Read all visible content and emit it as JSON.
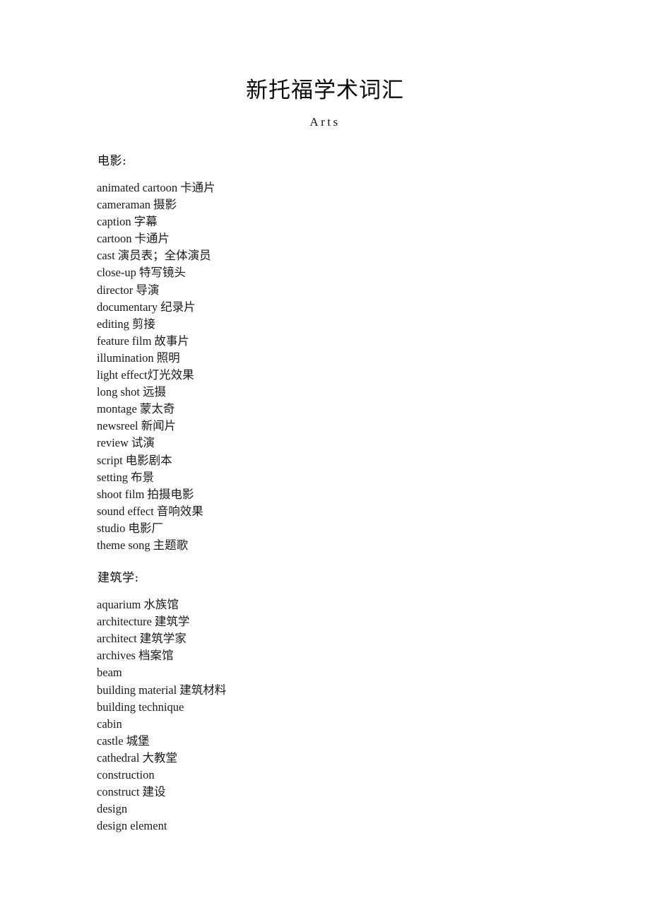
{
  "document": {
    "title": "新托福学术词汇",
    "subtitle": "Arts",
    "sections": [
      {
        "heading": "电影:",
        "entries": [
          {
            "term": "animated cartoon",
            "gloss": "卡通片"
          },
          {
            "term": "cameraman",
            "gloss": "摄影"
          },
          {
            "term": "caption",
            "gloss": "字幕"
          },
          {
            "term": "cartoon",
            "gloss": "卡通片"
          },
          {
            "term": "cast",
            "gloss": "演员表；全体演员"
          },
          {
            "term": "close-up",
            "gloss": "特写镜头"
          },
          {
            "term": "director",
            "gloss": "导演"
          },
          {
            "term": "documentary",
            "gloss": "纪录片"
          },
          {
            "term": "editing",
            "gloss": "剪接"
          },
          {
            "term": "feature film",
            "gloss": "故事片"
          },
          {
            "term": "illumination",
            "gloss": "照明"
          },
          {
            "term": "light effect",
            "gloss": "灯光效果",
            "tight": true
          },
          {
            "term": "long shot",
            "gloss": "远摄"
          },
          {
            "term": "montage",
            "gloss": "蒙太奇"
          },
          {
            "term": "newsreel",
            "gloss": "新闻片"
          },
          {
            "term": "review",
            "gloss": "试演"
          },
          {
            "term": "script",
            "gloss": "电影剧本"
          },
          {
            "term": "setting",
            "gloss": "布景"
          },
          {
            "term": "shoot film",
            "gloss": "拍摄电影"
          },
          {
            "term": "sound effect",
            "gloss": "音响效果"
          },
          {
            "term": "studio",
            "gloss": "电影厂"
          },
          {
            "term": "theme song",
            "gloss": "主题歌"
          }
        ]
      },
      {
        "heading": "建筑学:",
        "entries": [
          {
            "term": "aquarium",
            "gloss": "水族馆"
          },
          {
            "term": "architecture",
            "gloss": "建筑学"
          },
          {
            "term": "architect",
            "gloss": "建筑学家"
          },
          {
            "term": "archives",
            "gloss": "档案馆"
          },
          {
            "term": "beam",
            "gloss": ""
          },
          {
            "term": "building material",
            "gloss": "建筑材料"
          },
          {
            "term": "building technique",
            "gloss": ""
          },
          {
            "term": "cabin",
            "gloss": ""
          },
          {
            "term": "castle",
            "gloss": "城堡"
          },
          {
            "term": "cathedral",
            "gloss": "大教堂"
          },
          {
            "term": "construction",
            "gloss": ""
          },
          {
            "term": "construct",
            "gloss": "建设"
          },
          {
            "term": "design",
            "gloss": ""
          },
          {
            "term": "design element",
            "gloss": ""
          }
        ]
      }
    ]
  }
}
